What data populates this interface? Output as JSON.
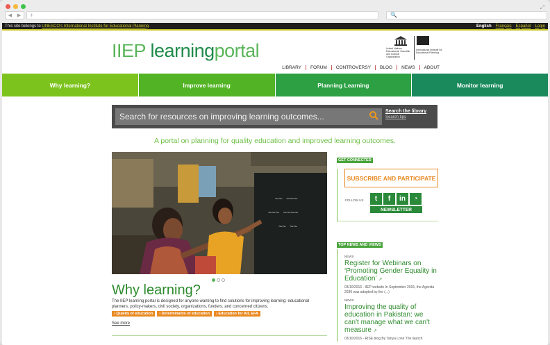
{
  "browser": {
    "new_tab": "+",
    "url_search": "🔍"
  },
  "topbar": {
    "notice_prefix": "This site belongs to ",
    "notice_link": "UNESCO's International Institute for Educational Planning",
    "languages": [
      "English",
      "Français",
      "Español"
    ],
    "login": "Login"
  },
  "header": {
    "logo_part1": "IIEP ",
    "logo_part2": "learning",
    "logo_part3": "portal",
    "unesco_text": "United Nations Educational, Scientific and Cultural Organization",
    "iiep_text": "International Institute for Educational Planning",
    "menu": [
      "LIBRARY",
      "FORUM",
      "CONTROVERSY",
      "BLOG",
      "NEWS",
      "ABOUT"
    ]
  },
  "nav": [
    "Why learning?",
    "Improve learning",
    "Planning Learning",
    "Monitor learning"
  ],
  "search": {
    "placeholder": "Search for resources on improving learning outcomes...",
    "library_link": "Search the library",
    "tips_link": "Search tips"
  },
  "tagline": "A portal on planning for quality education and improved learning outcomes.",
  "feature": {
    "title": "Why learning?",
    "description": "The IIEP learning portal is designed for anyone wanting to find solutions for improving learning: educational planners, policy-makers, civil society, organizations, funders, and concerned citizens.",
    "tags": [
      "› Quality of education",
      "› Determinants of education",
      "› Education for All, EFA"
    ],
    "see_more": "See more"
  },
  "sidebar": {
    "connected_head": "GET CONNECTED",
    "subscribe": "SUBSCRIBE AND PARTICIPATE",
    "follow_label": "FOLLOW US",
    "social": [
      "t",
      "f",
      "in",
      "rss"
    ],
    "newsletter": "NEWSLETTER",
    "news_head": "TOP NEWS AND VIEWS",
    "news": [
      {
        "kicker": "NEWS",
        "title": "Register for Webinars on ‘Promoting Gender Equality in Education’",
        "meta": "03/10/2016 - IIEP website In September 2015, the Agenda 2030 was adopted by the (...)"
      },
      {
        "kicker": "NEWS",
        "title": "Improving the quality of education in Pakistan: we can't manage what we can't measure",
        "meta": "03/10/2016 - RISE blog By Tanya Lone The launch"
      }
    ]
  },
  "colors": {
    "nav1": "#7dc31e",
    "nav2": "#52b324",
    "nav3": "#2da044",
    "nav4": "#1a8a5c",
    "accent_orange": "#e98a23",
    "title_green": "#2c8a2c"
  }
}
